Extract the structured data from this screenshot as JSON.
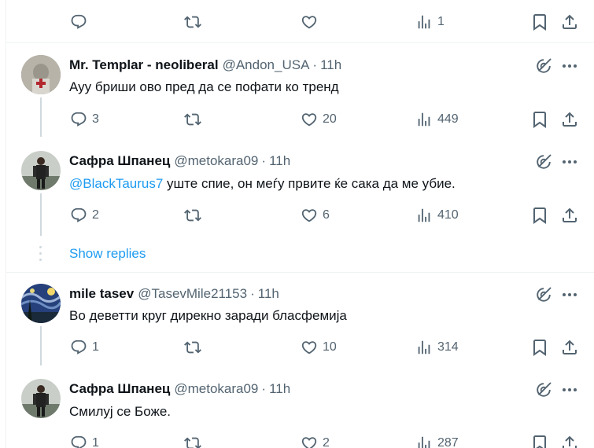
{
  "top_actions": {
    "views": "1"
  },
  "tweets": [
    {
      "name": "Mr. Templar - neoliberal",
      "handle": "@Andon_USA",
      "time": "11h",
      "text": "Ауу бриши ово пред да се пофати ко тренд",
      "replies": "3",
      "likes": "20",
      "views": "449"
    },
    {
      "name": "Сафра Шпанец",
      "handle": "@metokara09",
      "time": "11h",
      "mention": "@BlackTaurus7",
      "text": " уште спие, он меѓу првите ќе сака да ме убие.",
      "replies": "2",
      "likes": "6",
      "views": "410"
    },
    {
      "name": "mile tasev",
      "handle": "@TasevMile21153",
      "time": "11h",
      "text": "Во деветти круг дирекно заради бласфемија",
      "replies": "1",
      "likes": "10",
      "views": "314"
    },
    {
      "name": "Сафра Шпанец",
      "handle": "@metokara09",
      "time": "11h",
      "text": "Смилуј се Боже.",
      "replies": "1",
      "likes": "2",
      "views": "287"
    }
  ],
  "show_replies_label": "Show replies",
  "separator": "·",
  "colors": {
    "link": "#1d9bf0",
    "muted": "#536471",
    "text": "#0f1419",
    "border": "#eff3f4",
    "thread": "#cfd9de"
  },
  "icons": [
    "reply-icon",
    "retweet-icon",
    "like-icon",
    "views-icon",
    "bookmark-icon",
    "share-icon",
    "grok-icon",
    "more-icon"
  ]
}
